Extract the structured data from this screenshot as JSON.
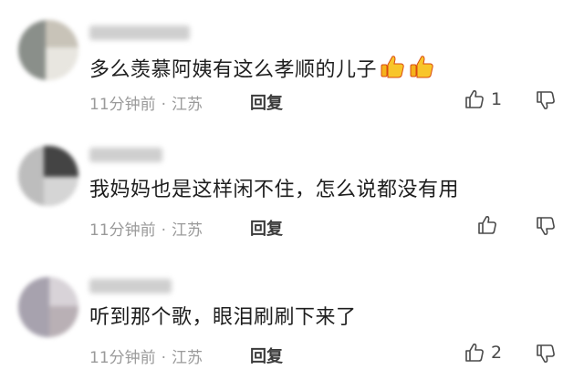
{
  "comments": [
    {
      "text": "多么羡慕阿姨有这么孝顺的儿子",
      "emoji": [
        "thumbs-up-icon",
        "thumbs-up-icon"
      ],
      "time": "11分钟前",
      "location": "江苏",
      "reply_label": "回复",
      "likes": "1"
    },
    {
      "text": "我妈妈也是这样闲不住，怎么说都没有用",
      "time": "11分钟前",
      "location": "江苏",
      "reply_label": "回复",
      "likes": ""
    },
    {
      "text": "听到那个歌，眼泪刷刷下来了",
      "time": "11分钟前",
      "location": "江苏",
      "reply_label": "回复",
      "likes": "2"
    }
  ],
  "separator": "·",
  "colors": {
    "meta": "#9a9a9a",
    "text": "#1e1e1e",
    "emoji": "#f5b21b"
  }
}
